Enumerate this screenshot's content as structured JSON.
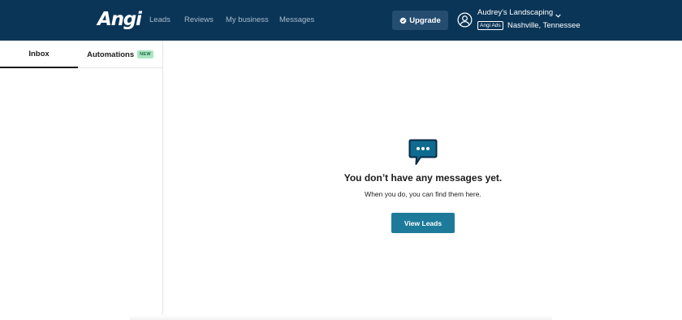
{
  "header": {
    "logo": "Angi",
    "nav": [
      "Leads",
      "Reviews",
      "My business",
      "Messages"
    ],
    "upgrade_label": "Upgrade",
    "account_name": "Audrey's Landscaping",
    "ads_tag": "Angi Ads",
    "location": "Nashville, Tennessee",
    "icons": {
      "upgrade": "verified-badge-icon",
      "avatar": "user-circle-icon",
      "account_menu": "chevron-down-icon"
    }
  },
  "sidebar": {
    "tabs": [
      {
        "label": "Inbox",
        "active": true
      },
      {
        "label": "Automations",
        "badge": "NEW"
      }
    ]
  },
  "empty_state": {
    "icon": "chat-bubble-icon",
    "title": "You don’t have any messages yet.",
    "subtitle": "When you do, you can find them here.",
    "button_label": "View Leads"
  },
  "colors": {
    "header_bg": "#0a3557",
    "upgrade_bg": "#244d70",
    "accent": "#1d7a9a",
    "new_badge_bg": "#a8e6c3"
  }
}
